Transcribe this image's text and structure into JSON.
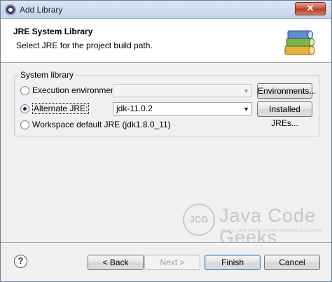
{
  "window": {
    "title": "Add Library",
    "close_label": "✕"
  },
  "header": {
    "title": "JRE System Library",
    "description": "Select JRE for the project build path."
  },
  "group": {
    "legend": "System library",
    "options": [
      {
        "label": "Execution environment:",
        "selected": false,
        "combo_value": "",
        "button": "Environments..."
      },
      {
        "label": "Alternate JRE:",
        "selected": true,
        "combo_value": "jdk-11.0.2",
        "button": "Installed JREs..."
      },
      {
        "label": "Workspace default JRE (jdk1.8.0_11)",
        "selected": false
      }
    ]
  },
  "footer": {
    "help": "?",
    "back": "< Back",
    "next": "Next >",
    "finish": "Finish",
    "cancel": "Cancel"
  },
  "watermark": {
    "logo": "JCG",
    "brand": "Java Code Geeks",
    "tagline": "JAVA 2 JAVA DEVELOPERS RESOURCE CENTER"
  }
}
